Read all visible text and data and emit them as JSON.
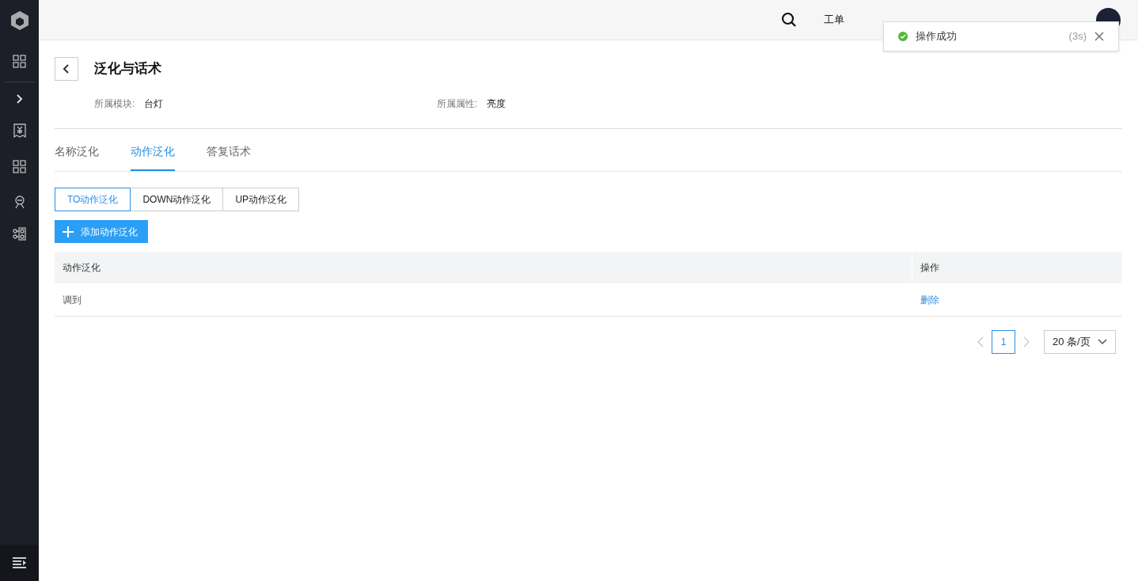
{
  "sidebar": {
    "items": [
      {
        "kind": "logo"
      },
      {
        "kind": "grid"
      },
      {
        "kind": "divider"
      },
      {
        "kind": "expand"
      },
      {
        "kind": "bill"
      },
      {
        "kind": "grid"
      },
      {
        "kind": "person"
      },
      {
        "kind": "nodes"
      }
    ],
    "footer": {
      "kind": "collapse"
    }
  },
  "topbar": {
    "links": [
      "工单"
    ]
  },
  "toast": {
    "message": "操作成功",
    "countdown": "(3s)"
  },
  "page": {
    "title": "泛化与话术",
    "fields": [
      {
        "label": "所属模块:",
        "value": "台灯"
      },
      {
        "label": "所属属性:",
        "value": "亮度"
      }
    ]
  },
  "tabs": [
    {
      "label": "名称泛化",
      "selected": false
    },
    {
      "label": "动作泛化",
      "selected": true
    },
    {
      "label": "答复话术",
      "selected": false
    }
  ],
  "segments": [
    {
      "label": "TO动作泛化",
      "selected": true
    },
    {
      "label": "DOWN动作泛化",
      "selected": false
    },
    {
      "label": "UP动作泛化",
      "selected": false
    }
  ],
  "add_button": "添加动作泛化",
  "table": {
    "columns": [
      "动作泛化",
      "操作"
    ],
    "rows": [
      {
        "cells": [
          "调到"
        ],
        "action": "删除"
      }
    ]
  },
  "pagination": {
    "pages": [
      {
        "label": "1",
        "selected": true
      }
    ],
    "page_size": "20 条/页"
  }
}
